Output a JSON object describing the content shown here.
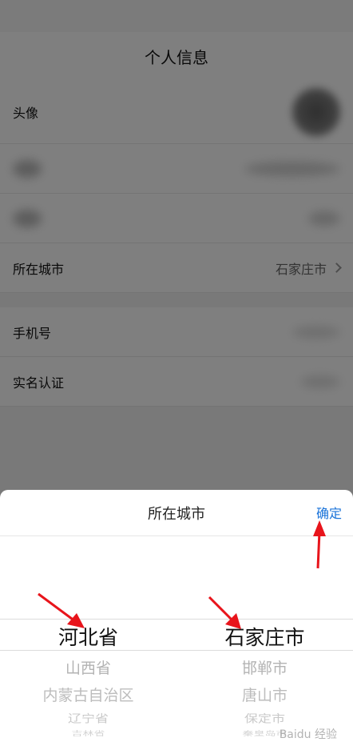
{
  "page": {
    "title": "个人信息",
    "rows": {
      "avatar_label": "头像",
      "city_label": "所在城市",
      "city_value": "石家庄市",
      "phone_label": "手机号",
      "realname_label": "实名认证"
    }
  },
  "sheet": {
    "title": "所在城市",
    "confirm_label": "确定",
    "provinces": {
      "selected": "河北省",
      "next": [
        "山西省",
        "内蒙古自治区",
        "辽宁省",
        "吉林省"
      ]
    },
    "cities": {
      "selected": "石家庄市",
      "next": [
        "邯郸市",
        "唐山市",
        "保定市",
        "秦皇岛市"
      ]
    }
  },
  "colors": {
    "accent": "#1a73d9",
    "arrow": "#e8141b"
  },
  "watermark": "Baidu 经验"
}
